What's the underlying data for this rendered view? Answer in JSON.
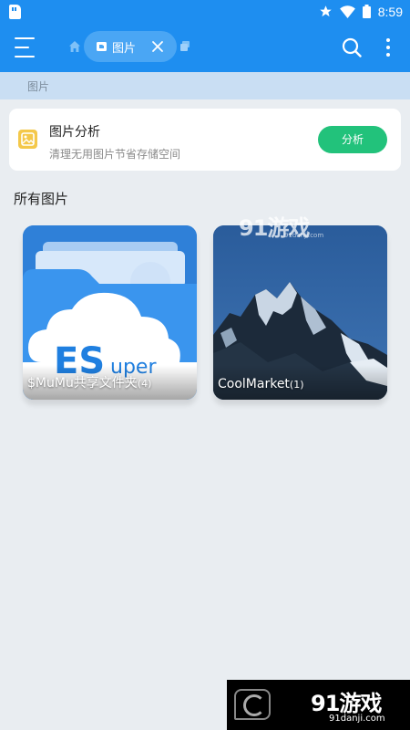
{
  "status_bar": {
    "time": "8:59",
    "icons": [
      "sd-card-icon",
      "star-icon",
      "wifi-icon",
      "battery-icon"
    ]
  },
  "toolbar": {
    "current_tab": "图片",
    "icons": [
      "menu-icon",
      "home-icon",
      "image-icon",
      "close-icon",
      "stack-icon",
      "search-icon",
      "more-vertical-icon"
    ]
  },
  "breadcrumb": {
    "path": "图片"
  },
  "analysis_card": {
    "title": "图片分析",
    "subtitle": "清理无用图片节省存储空间",
    "button_label": "分析",
    "icon": "image-icon"
  },
  "section": {
    "title": "所有图片"
  },
  "folders": [
    {
      "name": "$MuMu共享文件夹",
      "count": "(4)",
      "thumbnail": "esuper-folder-art"
    },
    {
      "name": "CoolMarket",
      "count": "(1)",
      "thumbnail": "mountain-photo"
    }
  ],
  "watermark": {
    "top_main": "91游戏",
    "top_sub": "91danji.com",
    "bottom_main": "91游戏",
    "bottom_sub": "91danji.com"
  },
  "colors": {
    "primary": "#1e8ef0",
    "tab_chip": "#4aa6f4",
    "breadcrumb_bg": "#c9def3",
    "page_bg": "#e9edf1",
    "accent_green": "#22c27b",
    "icon_yellow": "#f4c84a"
  }
}
